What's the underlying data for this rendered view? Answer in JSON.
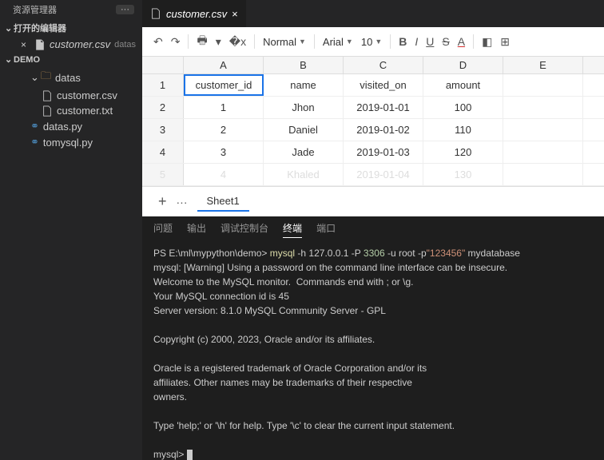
{
  "sidebar": {
    "title": "资源管理器",
    "open_editors_label": "打开的编辑器",
    "open_editor": {
      "name": "customer.csv",
      "hint": "datas"
    },
    "project": "DEMO",
    "tree": {
      "folder": "datas",
      "files_in_folder": [
        "customer.csv",
        "customer.txt"
      ],
      "py_files": [
        "datas.py",
        "tomysql.py"
      ]
    }
  },
  "tab": {
    "name": "customer.csv",
    "close": "×"
  },
  "toolbar": {
    "normal": "Normal",
    "font": "Arial",
    "size": "10",
    "b": "B",
    "i": "I",
    "u": "U",
    "s": "S",
    "a": "A"
  },
  "columns": [
    "A",
    "B",
    "C",
    "D",
    "E"
  ],
  "headers": [
    "customer_id",
    "name",
    "visited_on",
    "amount",
    ""
  ],
  "rows": [
    [
      "1",
      "Jhon",
      "2019-01-01",
      "100",
      ""
    ],
    [
      "2",
      "Daniel",
      "2019-01-02",
      "110",
      ""
    ],
    [
      "3",
      "Jade",
      "2019-01-03",
      "120",
      ""
    ],
    [
      "4",
      "Khaled",
      "2019-01-04",
      "130",
      ""
    ]
  ],
  "sheet_tab": "Sheet1",
  "panel_tabs": {
    "problems": "问题",
    "output": "输出",
    "debug": "调试控制台",
    "terminal": "终端",
    "ports": "端口"
  },
  "terminal": {
    "ps": "PS E:\\ml\\mypython\\demo> ",
    "cmd": "mysql",
    "args1": " -h 127.0.0.1 -P ",
    "port": "3306",
    "args2": " -u root -p",
    "pw": "\"123456\"",
    "db": " mydatabase",
    "body": "mysql: [Warning] Using a password on the command line interface can be insecure.\nWelcome to the MySQL monitor.  Commands end with ; or \\g.\nYour MySQL connection id is 45\nServer version: 8.1.0 MySQL Community Server - GPL\n\nCopyright (c) 2000, 2023, Oracle and/or its affiliates.\n\nOracle is a registered trademark of Oracle Corporation and/or its\naffiliates. Other names may be trademarks of their respective\nowners.\n\nType 'help;' or '\\h' for help. Type '\\c' to clear the current input statement.\n",
    "prompt": "mysql> "
  }
}
